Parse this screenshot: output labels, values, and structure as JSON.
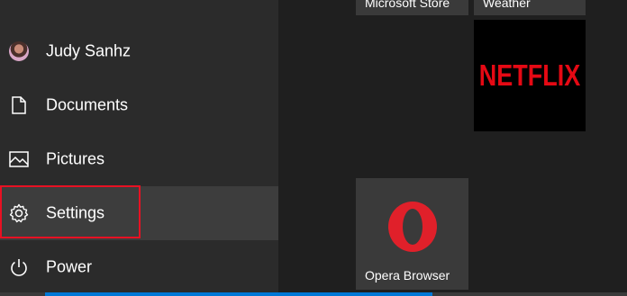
{
  "sidebar": {
    "items": [
      {
        "label": "Judy Sanhz",
        "icon": "user-avatar"
      },
      {
        "label": "Documents",
        "icon": "document-icon"
      },
      {
        "label": "Pictures",
        "icon": "pictures-icon"
      },
      {
        "label": "Settings",
        "icon": "gear-icon"
      },
      {
        "label": "Power",
        "icon": "power-icon"
      }
    ],
    "highlight_color": "#e81123"
  },
  "tiles": {
    "microsoft_store": {
      "label": "Microsoft Store"
    },
    "weather": {
      "label": "Weather"
    },
    "netflix": {
      "logo_text": "NETFLIX",
      "brand_color": "#e50914"
    },
    "opera": {
      "label": "Opera Browser",
      "brand_color": "#e0202a"
    }
  },
  "accent_color": "#0078d7"
}
